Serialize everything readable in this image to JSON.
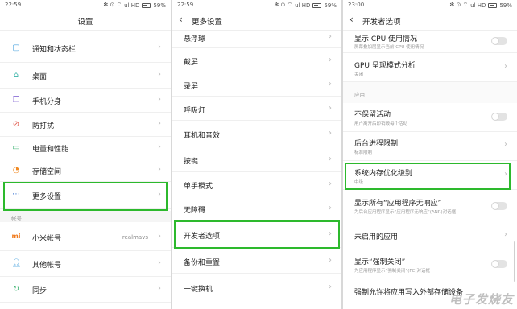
{
  "status": {
    "p1_time": "22:59",
    "p2_time": "22:59",
    "p3_time": "23:00",
    "signal": "ul HD",
    "battery1": "59%",
    "battery2": "59%",
    "battery3": "59%",
    "icons": "✻ ⊙ ⌔"
  },
  "panel1": {
    "title": "设置",
    "items": [
      {
        "label": "通知和状态栏",
        "icon": "notification-icon",
        "color": "#4aa3df"
      },
      {
        "label": "桌面",
        "icon": "home-icon",
        "color": "#3bb3a8"
      },
      {
        "label": "手机分身",
        "icon": "clone-icon",
        "color": "#8b6fd6"
      },
      {
        "label": "防打扰",
        "icon": "dnd-icon",
        "color": "#e0574a"
      },
      {
        "label": "电量和性能",
        "icon": "battery-icon",
        "color": "#3cb371"
      },
      {
        "label": "存储空间",
        "icon": "storage-icon",
        "color": "#f08a24"
      },
      {
        "label": "更多设置",
        "icon": "more-icon",
        "color": "#4a7fd6"
      }
    ],
    "section": "帐号",
    "account_items": [
      {
        "label": "小米帐号",
        "value": "realmavs",
        "icon": "mi-icon",
        "color": "#f07b1e"
      },
      {
        "label": "其他帐号",
        "icon": "user-icon",
        "color": "#4aa3df"
      },
      {
        "label": "同步",
        "icon": "sync-icon",
        "color": "#3cb371"
      }
    ]
  },
  "panel2": {
    "title": "更多设置",
    "items": [
      "悬浮球",
      "截屏",
      "录屏",
      "呼吸灯",
      "耳机和音效",
      "按键",
      "单手模式",
      "无障碍",
      "开发者选项",
      "备份和重置",
      "一键换机"
    ]
  },
  "panel3": {
    "title": "开发者选项",
    "items": [
      {
        "label": "显示 CPU 使用情况",
        "sub": "屏幕叠加层显示当前 CPU 使用情况",
        "toggle": true
      },
      {
        "label": "GPU 呈现模式分析",
        "sub": "关闭",
        "toggle": false
      }
    ],
    "section": "应用",
    "app_items": [
      {
        "label": "不保留活动",
        "sub": "用户离开后即销毁每个活动",
        "toggle": true
      },
      {
        "label": "后台进程限制",
        "sub": "标准限制",
        "toggle": false
      },
      {
        "label": "系统内存优化级别",
        "sub": "中级",
        "toggle": false
      },
      {
        "label": "显示所有“应用程序无响应”",
        "sub": "为后台应用程序显示“应用程序无响应”(ANR)对话框",
        "toggle": true
      },
      {
        "label": "未启用的应用",
        "sub": "",
        "toggle": false
      },
      {
        "label": "显示“强制关闭”",
        "sub": "为应用程序显示“强制关闭”(FC)对话框",
        "toggle": true
      },
      {
        "label": "强制允许将应用写入外部存储设备",
        "sub": "",
        "toggle": false
      }
    ]
  },
  "watermark": "电子发烧友",
  "highlight_color": "#2db92d"
}
